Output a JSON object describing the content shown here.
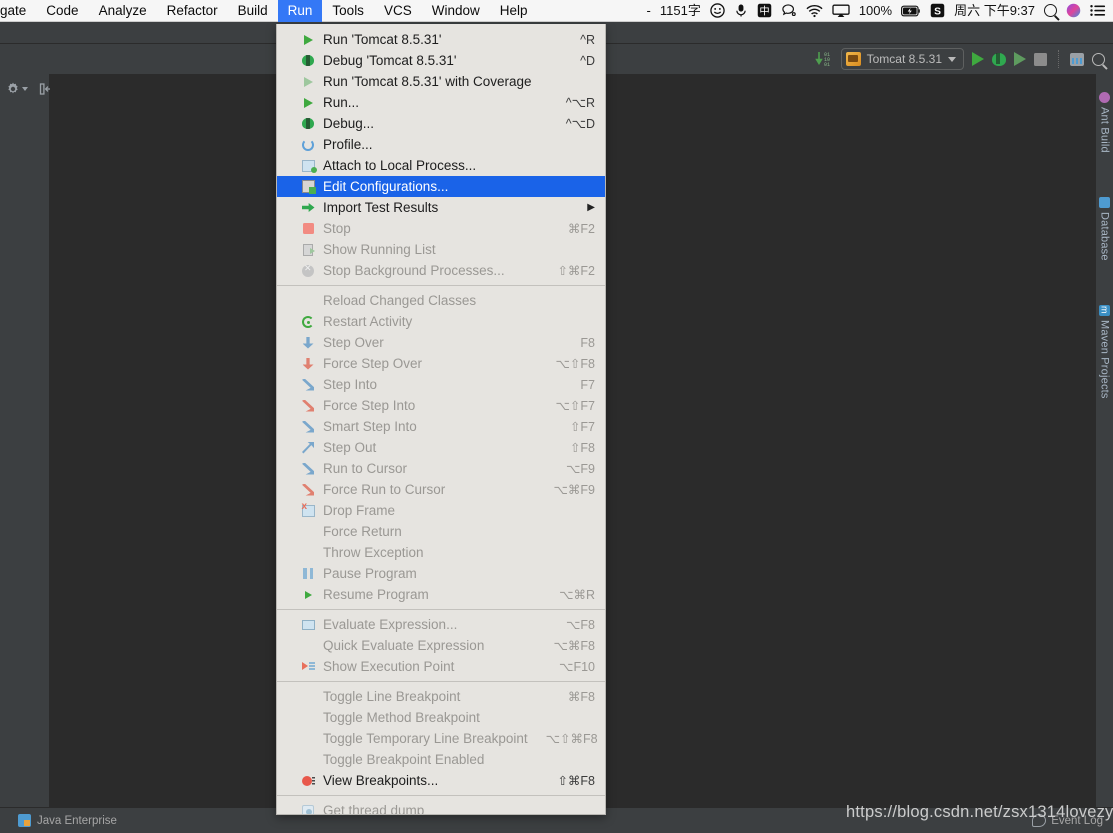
{
  "macos_menubar": {
    "items": [
      {
        "label": "gate",
        "active": false
      },
      {
        "label": "Code",
        "active": false
      },
      {
        "label": "Analyze",
        "active": false
      },
      {
        "label": "Refactor",
        "active": false
      },
      {
        "label": "Build",
        "active": false
      },
      {
        "label": "Run",
        "active": true
      },
      {
        "label": "Tools",
        "active": false
      },
      {
        "label": "VCS",
        "active": false
      },
      {
        "label": "Window",
        "active": false
      },
      {
        "label": "Help",
        "active": false
      }
    ],
    "status_items": [
      {
        "name": "dash-text",
        "label": "-"
      },
      {
        "name": "word-count",
        "label": "1151字"
      },
      {
        "name": "emoji-icon",
        "label": "☺"
      },
      {
        "name": "microphone-icon",
        "label": "🎙"
      },
      {
        "name": "input-method-chinese",
        "label": "中"
      },
      {
        "name": "chat-bubble-icon",
        "label": "💬"
      },
      {
        "name": "wifi-icon",
        "label": "wifi"
      },
      {
        "name": "airplay-icon",
        "label": "airplay"
      },
      {
        "name": "battery-percent",
        "label": "100%"
      },
      {
        "name": "battery-icon",
        "label": "battery"
      },
      {
        "name": "sogou-icon",
        "label": "S"
      },
      {
        "name": "clock",
        "label": "周六 下午9:37"
      },
      {
        "name": "spotlight-search-icon",
        "label": "search"
      },
      {
        "name": "siri-icon",
        "label": "siri"
      },
      {
        "name": "control-center-icon",
        "label": "list"
      }
    ]
  },
  "toolbar": {
    "run_config_name": "Tomcat 8.5.31",
    "icons": [
      {
        "name": "update-running-application-icon"
      },
      {
        "name": "run-icon"
      },
      {
        "name": "debug-icon"
      },
      {
        "name": "run-with-coverage-icon"
      },
      {
        "name": "stop-icon"
      },
      {
        "name": "database-icon"
      },
      {
        "name": "search-everywhere-icon"
      }
    ]
  },
  "left_toolbar": {
    "icons": [
      {
        "name": "settings-gear-icon"
      },
      {
        "name": "collapse-panel-icon"
      }
    ]
  },
  "right_tool_windows": [
    {
      "label": "Ant Build",
      "icon": "ant-icon"
    },
    {
      "label": "Database",
      "icon": "database-icon"
    },
    {
      "label": "Maven Projects",
      "icon": "maven-icon"
    }
  ],
  "statusbar": {
    "left_label": "Java Enterprise",
    "right_label": "Event Log"
  },
  "watermark": "https://blog.csdn.net/zsx1314lovezyf",
  "run_menu": {
    "groups": [
      {
        "items": [
          {
            "label": "Run 'Tomcat 8.5.31'",
            "accel": "^R",
            "icon": "run-icon",
            "state": "enabled",
            "submenu": false
          },
          {
            "label": "Debug 'Tomcat 8.5.31'",
            "accel": "^D",
            "icon": "debug-icon",
            "state": "enabled",
            "submenu": false
          },
          {
            "label": "Run 'Tomcat 8.5.31' with Coverage",
            "accel": "",
            "icon": "coverage-icon",
            "state": "enabled",
            "submenu": false
          },
          {
            "label": "Run...",
            "accel": "^⌥R",
            "icon": "run-icon",
            "state": "enabled",
            "submenu": false
          },
          {
            "label": "Debug...",
            "accel": "^⌥D",
            "icon": "debug-icon",
            "state": "enabled",
            "submenu": false
          },
          {
            "label": "Profile...",
            "accel": "",
            "icon": "profile-icon",
            "state": "enabled",
            "submenu": false
          },
          {
            "label": "Attach to Local Process...",
            "accel": "",
            "icon": "attach-icon",
            "state": "enabled",
            "submenu": false
          },
          {
            "label": "Edit Configurations...",
            "accel": "",
            "icon": "edit-configurations-icon",
            "state": "selected",
            "submenu": false
          },
          {
            "label": "Import Test Results",
            "accel": "",
            "icon": "import-icon",
            "state": "enabled",
            "submenu": true
          },
          {
            "label": "Stop",
            "accel": "⌘F2",
            "icon": "stop-icon",
            "state": "disabled",
            "submenu": false
          },
          {
            "label": "Show Running List",
            "accel": "",
            "icon": "running-list-icon",
            "state": "disabled",
            "submenu": false
          },
          {
            "label": "Stop Background Processes...",
            "accel": "⇧⌘F2",
            "icon": "stop-background-icon",
            "state": "disabled",
            "submenu": false
          }
        ]
      },
      {
        "items": [
          {
            "label": "Reload Changed Classes",
            "accel": "",
            "icon": "",
            "state": "disabled",
            "submenu": false
          },
          {
            "label": "Restart Activity",
            "accel": "",
            "icon": "restart-icon",
            "state": "disabled",
            "submenu": false
          },
          {
            "label": "Step Over",
            "accel": "F8",
            "icon": "step-over-icon",
            "state": "disabled",
            "submenu": false
          },
          {
            "label": "Force Step Over",
            "accel": "⌥⇧F8",
            "icon": "force-step-over-icon",
            "state": "disabled",
            "submenu": false
          },
          {
            "label": "Step Into",
            "accel": "F7",
            "icon": "step-into-icon",
            "state": "disabled",
            "submenu": false
          },
          {
            "label": "Force Step Into",
            "accel": "⌥⇧F7",
            "icon": "force-step-into-icon",
            "state": "disabled",
            "submenu": false
          },
          {
            "label": "Smart Step Into",
            "accel": "⇧F7",
            "icon": "smart-step-into-icon",
            "state": "disabled",
            "submenu": false
          },
          {
            "label": "Step Out",
            "accel": "⇧F8",
            "icon": "step-out-icon",
            "state": "disabled",
            "submenu": false
          },
          {
            "label": "Run to Cursor",
            "accel": "⌥F9",
            "icon": "run-to-cursor-icon",
            "state": "disabled",
            "submenu": false
          },
          {
            "label": "Force Run to Cursor",
            "accel": "⌥⌘F9",
            "icon": "force-run-to-cursor-icon",
            "state": "disabled",
            "submenu": false
          },
          {
            "label": "Drop Frame",
            "accel": "",
            "icon": "drop-frame-icon",
            "state": "disabled",
            "submenu": false
          },
          {
            "label": "Force Return",
            "accel": "",
            "icon": "",
            "state": "disabled",
            "submenu": false
          },
          {
            "label": "Throw Exception",
            "accel": "",
            "icon": "",
            "state": "disabled",
            "submenu": false
          },
          {
            "label": "Pause Program",
            "accel": "",
            "icon": "pause-icon",
            "state": "disabled",
            "submenu": false
          },
          {
            "label": "Resume Program",
            "accel": "⌥⌘R",
            "icon": "resume-icon",
            "state": "disabled",
            "submenu": false
          }
        ]
      },
      {
        "items": [
          {
            "label": "Evaluate Expression...",
            "accel": "⌥F8",
            "icon": "evaluate-icon",
            "state": "disabled",
            "submenu": false
          },
          {
            "label": "Quick Evaluate Expression",
            "accel": "⌥⌘F8",
            "icon": "",
            "state": "disabled",
            "submenu": false
          },
          {
            "label": "Show Execution Point",
            "accel": "⌥F10",
            "icon": "execution-point-icon",
            "state": "disabled",
            "submenu": false
          }
        ]
      },
      {
        "items": [
          {
            "label": "Toggle Line Breakpoint",
            "accel": "⌘F8",
            "icon": "",
            "state": "disabled",
            "submenu": false
          },
          {
            "label": "Toggle Method Breakpoint",
            "accel": "",
            "icon": "",
            "state": "disabled",
            "submenu": false
          },
          {
            "label": "Toggle Temporary Line Breakpoint",
            "accel": "⌥⇧⌘F8",
            "icon": "",
            "state": "disabled",
            "submenu": false
          },
          {
            "label": "Toggle Breakpoint Enabled",
            "accel": "",
            "icon": "",
            "state": "disabled",
            "submenu": false
          },
          {
            "label": "View Breakpoints...",
            "accel": "⇧⌘F8",
            "icon": "view-breakpoints-icon",
            "state": "enabled",
            "submenu": false
          }
        ]
      },
      {
        "items": [
          {
            "label": "Get thread dump",
            "accel": "",
            "icon": "thread-dump-icon",
            "state": "disabled",
            "submenu": false
          }
        ]
      }
    ]
  }
}
